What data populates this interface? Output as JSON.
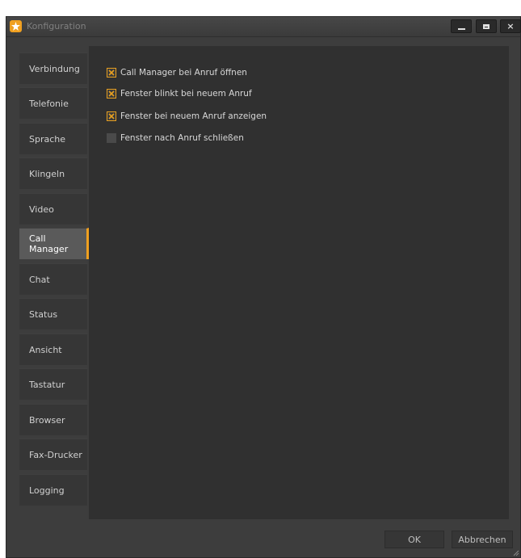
{
  "window": {
    "title": "Konfiguration",
    "controls": {
      "minimize": "minimize",
      "maximize": "maximize",
      "close": "×"
    }
  },
  "sidebar": {
    "items": [
      {
        "label": "Verbindung",
        "active": false
      },
      {
        "label": "Telefonie",
        "active": false
      },
      {
        "label": "Sprache",
        "active": false
      },
      {
        "label": "Klingeln",
        "active": false
      },
      {
        "label": "Video",
        "active": false
      },
      {
        "label": "Call Manager",
        "active": true
      },
      {
        "label": "Chat",
        "active": false
      },
      {
        "label": "Status",
        "active": false
      },
      {
        "label": "Ansicht",
        "active": false
      },
      {
        "label": "Tastatur",
        "active": false
      },
      {
        "label": "Browser",
        "active": false
      },
      {
        "label": "Fax-Drucker",
        "active": false
      },
      {
        "label": "Logging",
        "active": false
      }
    ]
  },
  "options": [
    {
      "label": "Call Manager bei Anruf öffnen",
      "checked": true
    },
    {
      "label": "Fenster blinkt bei neuem Anruf",
      "checked": true
    },
    {
      "label": "Fenster bei neuem Anruf anzeigen",
      "checked": true
    },
    {
      "label": "Fenster nach Anruf schließen",
      "checked": false
    }
  ],
  "buttons": {
    "ok": "OK",
    "cancel": "Abbrechen"
  },
  "colors": {
    "accent": "#f0a020",
    "background": "#3d3d3d",
    "panel": "#303030"
  }
}
